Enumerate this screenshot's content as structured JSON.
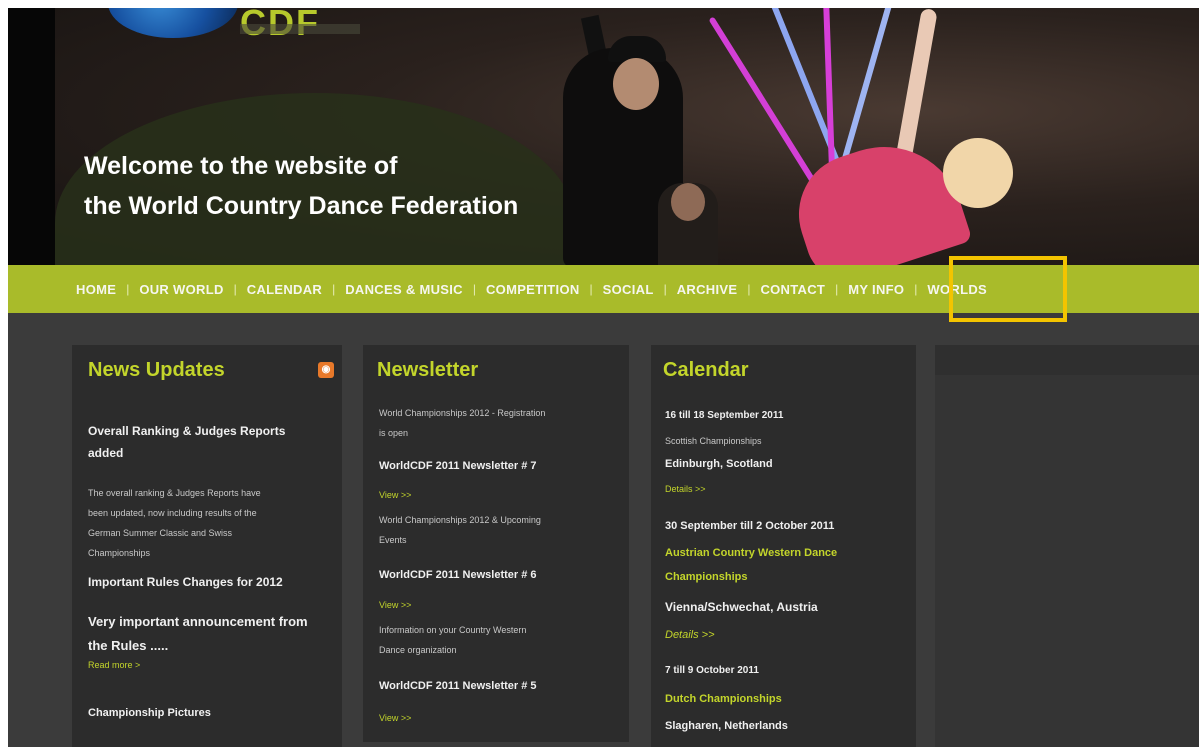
{
  "hero": {
    "logo_text": "CDF",
    "title_line1": "Welcome to the website of",
    "title_line2": "the World Country Dance Federation"
  },
  "nav": {
    "items": [
      "HOME",
      "OUR WORLD",
      "CALENDAR",
      "DANCES & MUSIC",
      "COMPETITION",
      "SOCIAL",
      "ARCHIVE",
      "CONTACT",
      "MY INFO",
      "WORLDS"
    ],
    "highlighted": "MY INFO",
    "accent_color": "#a9bb2a",
    "highlight_color": "#f3c400"
  },
  "news": {
    "title": "News Updates",
    "rss_icon": "rss-icon",
    "item1_title_a": "Overall Ranking & Judges Reports",
    "item1_title_b": "added",
    "item1_body_a": "The overall ranking & Judges Reports have",
    "item1_body_b": "been updated, now including results of the",
    "item1_body_c": "German Summer Classic and Swiss",
    "item1_body_d": "Championships",
    "item2_title": "Important Rules Changes for 2012",
    "item3_title_a": "Very important announcement from",
    "item3_title_b": "the Rules .....",
    "read_more": "Read more >",
    "item4_title": "Championship Pictures"
  },
  "newsletter": {
    "title": "Newsletter",
    "n1_desc_a": "World Championships 2012 - Registration",
    "n1_desc_b": "is open",
    "n1_title": "WorldCDF 2011 Newsletter # 7",
    "n1_link": "View >>",
    "n2_desc_a": "World Championships 2012 & Upcoming",
    "n2_desc_b": "Events",
    "n2_title": "WorldCDF 2011 Newsletter # 6",
    "n2_link": "View >>",
    "n3_desc_a": "Information on your Country Western",
    "n3_desc_b": "Dance organization",
    "n3_title": "WorldCDF 2011 Newsletter # 5",
    "n3_link": "View >>"
  },
  "calendar": {
    "title": "Calendar",
    "e1_date": "16 till 18 September 2011",
    "e1_name": "Scottish Championships",
    "e1_place": "Edinburgh, Scotland",
    "e1_link": "Details >>",
    "e2_date": "30 September till 2 October 2011",
    "e2_name_a": "Austrian Country Western Dance",
    "e2_name_b": "Championships",
    "e2_place": "Vienna/Schwechat, Austria",
    "e2_link": "Details >>",
    "e3_date": "7 till 9 October 2011",
    "e3_name": "Dutch Championships",
    "e3_place": "Slagharen, Netherlands"
  }
}
